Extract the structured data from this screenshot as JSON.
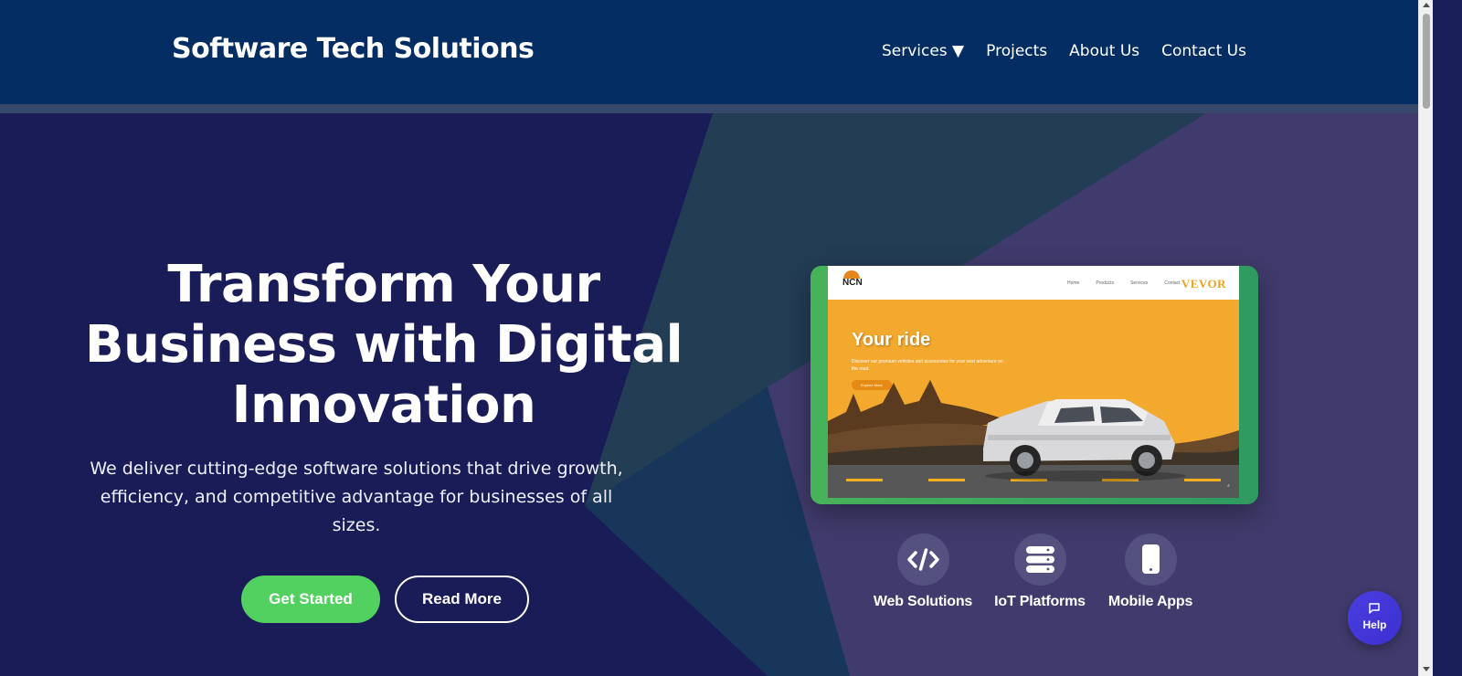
{
  "header": {
    "brand": "Software Tech Solutions",
    "nav": {
      "services": "Services ▼",
      "projects": "Projects",
      "about": "About Us",
      "contact": "Contact Us"
    }
  },
  "hero": {
    "title": "Transform Your Business with Digital Innovation",
    "subtitle": "We deliver cutting-edge software solutions that drive growth, efficiency, and competitive advantage for businesses of all sizes.",
    "primary_button": "Get Started",
    "secondary_button": "Read More"
  },
  "showcase": {
    "site_logo": "NCN",
    "site_brand": "VEVOR",
    "nav_links": [
      "Home",
      "Products",
      "Services",
      "Contact"
    ],
    "title": "Your ride",
    "description": "Discover our premium vehicles and accessories for your next adventure on the road.",
    "button": "Explore More"
  },
  "features": [
    {
      "label": "Web Solutions",
      "icon": "code-icon"
    },
    {
      "label": "IoT Platforms",
      "icon": "server-icon"
    },
    {
      "label": "Mobile Apps",
      "icon": "mobile-icon"
    }
  ],
  "help": {
    "label": "Help",
    "icon": "chat-icon"
  },
  "colors": {
    "header_bg": "#042d63",
    "hero_bg": "#1b1d57",
    "primary_green": "#52d160",
    "help_bg": "#4a3ee0"
  }
}
